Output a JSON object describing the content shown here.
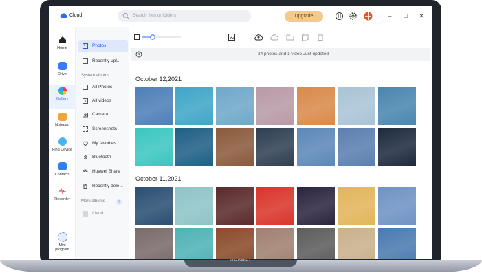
{
  "device": {
    "brand": "HUAWEI"
  },
  "app": {
    "name": "Cloud"
  },
  "search": {
    "placeholder": "Search files or folders"
  },
  "header": {
    "upgrade_label": "Upgrade"
  },
  "rail": [
    {
      "label": "Home",
      "icon": "home-icon"
    },
    {
      "label": "Drive",
      "icon": "drive-icon"
    },
    {
      "label": "Gallery",
      "icon": "gallery-icon"
    },
    {
      "label": "Notepad",
      "icon": "notepad-icon"
    },
    {
      "label": "Find Device",
      "icon": "find-device-icon"
    },
    {
      "label": "Contacts",
      "icon": "contacts-icon"
    },
    {
      "label": "Recorder",
      "icon": "recorder-icon"
    },
    {
      "label": "Mini program",
      "icon": "mini-program-icon"
    }
  ],
  "panel": {
    "top": [
      {
        "label": "Photos",
        "icon": "photos-icon"
      },
      {
        "label": "Recently upl...",
        "icon": "upload-icon"
      }
    ],
    "system_title": "System albums",
    "system": [
      {
        "label": "All Photos",
        "icon": "image-icon"
      },
      {
        "label": "All videos",
        "icon": "video-icon"
      },
      {
        "label": "Camera",
        "icon": "camera-icon"
      },
      {
        "label": "Screenshots",
        "icon": "screenshot-icon"
      },
      {
        "label": "My favorites",
        "icon": "heart-icon"
      },
      {
        "label": "Bluetooth",
        "icon": "bluetooth-icon"
      },
      {
        "label": "Huawei Share",
        "icon": "share-icon"
      },
      {
        "label": "Recently dele...",
        "icon": "trash-icon"
      }
    ],
    "more_title": "More albums",
    "more": [
      {
        "label": "friend",
        "icon": "album-icon"
      }
    ]
  },
  "status": "34 photos and 1 video   Just updated",
  "sections": [
    {
      "date": "October 12,2021",
      "photos": [
        "#4d7fb8",
        "#3fa6c7",
        "#6fa8c9",
        "#b89aa7",
        "#d98a4a",
        "#a9c4d6",
        "#4a86b0",
        "#3cc6c0",
        "#1f5f86",
        "#8a5a3c",
        "#2f3f52",
        "#5c88b8",
        "#5a7fb0",
        "#1e2a3f"
      ]
    },
    {
      "date": "October 11,2021",
      "photos": [
        "#2a4f73",
        "#8fc4c7",
        "#5b2a2a",
        "#d9352a",
        "#2b2440",
        "#e2b55a",
        "#6e93c4",
        "#7a6a6a",
        "#4fb2b5",
        "#8a4a2a",
        "#a08070",
        "#5c5c5c",
        "#c9b08a",
        "#4a7ab0"
      ]
    }
  ],
  "colors": {
    "accent": "#2d6df6",
    "upgrade": "#f3c98e",
    "frame": "#20242b"
  }
}
